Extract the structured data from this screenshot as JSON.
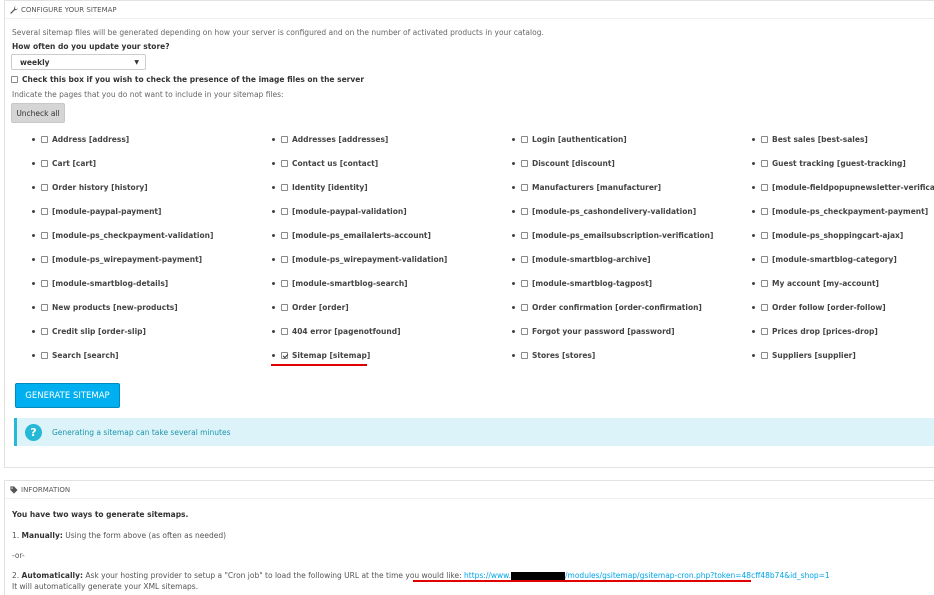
{
  "config": {
    "heading": "Configure your sitemap",
    "intro": "Several sitemap files will be generated depending on how your server is configured and on the number of activated products in your catalog.",
    "frequency_label": "How often do you update your store?",
    "frequency_value": "weekly",
    "image_check_label": "Check this box if you wish to check the presence of the image files on the server",
    "exclude_label": "Indicate the pages that you do not want to include in your sitemap files:",
    "uncheck_all": "Uncheck all",
    "generate_button": "Generate sitemap",
    "alert": "Generating a sitemap can take several minutes",
    "pages": [
      [
        "Address [address]",
        "Addresses [addresses]",
        "Login [authentication]",
        "Best sales [best-sales]"
      ],
      [
        "Cart [cart]",
        "Contact us [contact]",
        "Discount [discount]",
        "Guest tracking [guest-tracking]"
      ],
      [
        "Order history [history]",
        "Identity [identity]",
        "Manufacturers [manufacturer]",
        "[module-fieldpopupnewsletter-verification]"
      ],
      [
        "[module-paypal-payment]",
        "[module-paypal-validation]",
        "[module-ps_cashondelivery-validation]",
        "[module-ps_checkpayment-payment]"
      ],
      [
        "[module-ps_checkpayment-validation]",
        "[module-ps_emailalerts-account]",
        "[module-ps_emailsubscription-verification]",
        "[module-ps_shoppingcart-ajax]"
      ],
      [
        "[module-ps_wirepayment-payment]",
        "[module-ps_wirepayment-validation]",
        "[module-smartblog-archive]",
        "[module-smartblog-category]"
      ],
      [
        "[module-smartblog-details]",
        "[module-smartblog-search]",
        "[module-smartblog-tagpost]",
        "My account [my-account]"
      ],
      [
        "New products [new-products]",
        "Order [order]",
        "Order confirmation [order-confirmation]",
        "Order follow [order-follow]"
      ],
      [
        "Credit slip [order-slip]",
        "404 error [pagenotfound]",
        "Forgot your password [password]",
        "Prices drop [prices-drop]"
      ],
      [
        "Search [search]",
        "Sitemap [sitemap]",
        "Stores [stores]",
        "Suppliers [supplier]"
      ]
    ],
    "checked_page": "Sitemap [sitemap]"
  },
  "info": {
    "heading": "Information",
    "line1": "You have two ways to generate sitemaps.",
    "manual_num": "1.",
    "manual_label": "Manually:",
    "manual_text": "Using the form above (as often as needed)",
    "or": "-or-",
    "auto_num": "2.",
    "auto_label": "Automatically:",
    "auto_text": "Ask your hosting provider to setup a \"Cron job\" to load the following URL at the time you would like:",
    "url_prefix": "https://www.",
    "url_suffix": "/modules/gsitemap/gsitemap-cron.php?token=48cff48b74&id_shop=1",
    "auto_note": "It will automatically generate your XML sitemaps."
  },
  "colors": {
    "accent": "#00aff0",
    "alert_bg": "#dcf4f9",
    "alert_text": "#1e94ab",
    "highlight_underline": "#e00000"
  }
}
